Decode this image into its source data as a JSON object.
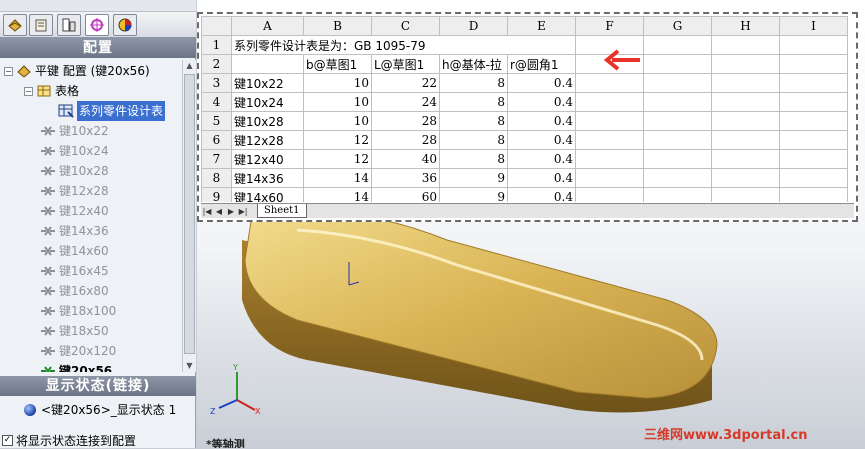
{
  "panel": {
    "tabs": [
      "feature-manager",
      "property-manager",
      "configuration-manager",
      "dimxpert-manager",
      "display-manager"
    ],
    "config_header": "配置",
    "root_label": "平键 配置 (键20x56)",
    "table_node_label": "表格",
    "design_table_label": "系列零件设计表",
    "configs": [
      "键10x22",
      "键10x24",
      "键10x28",
      "键12x28",
      "键12x40",
      "键14x36",
      "键14x60",
      "键16x45",
      "键16x80",
      "键18x100",
      "键18x50",
      "键20x120",
      "键20x56"
    ],
    "active_config": "键20x56",
    "display_header": "显示状态(链接)",
    "display_state": "<键20x56>_显示状态 1",
    "link_checkbox_label": "将显示状态连接到配置",
    "link_checked": true
  },
  "sheet": {
    "columns": [
      "A",
      "B",
      "C",
      "D",
      "E",
      "F",
      "G",
      "H",
      "I"
    ],
    "rows": [
      {
        "n": "1",
        "a": "系列零件设计表是为：GB 1095-79",
        "b": "",
        "c": "",
        "d": "",
        "e": ""
      },
      {
        "n": "2",
        "a": "",
        "b": "b@草图1",
        "c": "L@草图1",
        "d": "h@基体-拉",
        "e": "r@圆角1"
      },
      {
        "n": "3",
        "a": "键10x22",
        "b": "10",
        "c": "22",
        "d": "8",
        "e": "0.4"
      },
      {
        "n": "4",
        "a": "键10x24",
        "b": "10",
        "c": "24",
        "d": "8",
        "e": "0.4"
      },
      {
        "n": "5",
        "a": "键10x28",
        "b": "10",
        "c": "28",
        "d": "8",
        "e": "0.4"
      },
      {
        "n": "6",
        "a": "键12x28",
        "b": "12",
        "c": "28",
        "d": "8",
        "e": "0.4"
      },
      {
        "n": "7",
        "a": "键12x40",
        "b": "12",
        "c": "40",
        "d": "8",
        "e": "0.4"
      },
      {
        "n": "8",
        "a": "键14x36",
        "b": "14",
        "c": "36",
        "d": "9",
        "e": "0.4"
      },
      {
        "n": "9",
        "a": "键14x60",
        "b": "14",
        "c": "60",
        "d": "9",
        "e": "0.4"
      }
    ],
    "tab_name": "Sheet1"
  },
  "viewport": {
    "view_label": "*等轴测",
    "watermark": "三维网www.3dportal.cn",
    "part_color": "#c9a23c",
    "arrow_color": "#e8322a"
  }
}
